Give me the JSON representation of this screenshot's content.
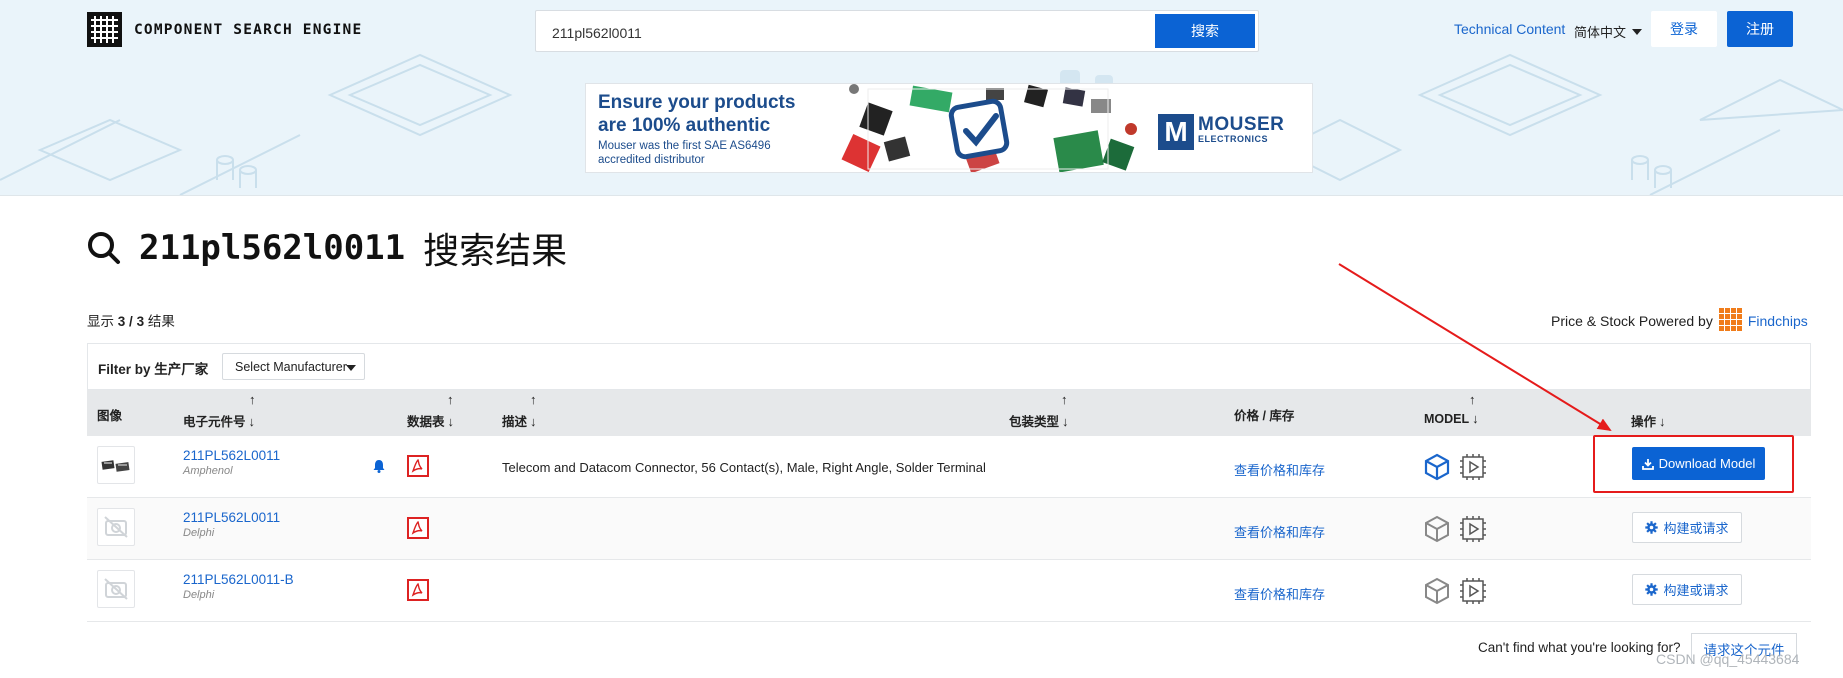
{
  "header": {
    "logo_text": "COMPONENT SEARCH ENGINE",
    "search_value": "211pl562l0011",
    "search_button": "搜索",
    "technical_content": "Technical Content",
    "language": "简体中文",
    "login": "登录",
    "register": "注册"
  },
  "banner": {
    "headline": "Ensure your products are 100% authentic",
    "subline": "Mouser was the first SAE AS6496 accredited distributor",
    "brand_letter": "M",
    "brand_name": "MOUSER",
    "brand_sub": "ELECTRONICS"
  },
  "results": {
    "query": "211pl562l0011",
    "title_suffix": "搜索结果",
    "count_prefix": "显示",
    "count_shown": "3",
    "count_sep": "/",
    "count_total": "3",
    "count_suffix": "结果",
    "powered_text": "Price & Stock Powered by",
    "powered_link": "Findchips"
  },
  "filter": {
    "label": "Filter by 生产厂家",
    "select_value": "Select Manufacturer"
  },
  "columns": {
    "image": "图像",
    "part_number": "电子元件号",
    "datasheet": "数据表",
    "description": "描述",
    "package": "包装类型",
    "price_stock": "价格 / 库存",
    "model": "MODEL",
    "actions": "操作"
  },
  "rows": [
    {
      "part_number": "211PL562L0011",
      "manufacturer": "Amphenol",
      "description": "Telecom and Datacom Connector, 56 Contact(s), Male, Right Angle, Solder Terminal",
      "price_link": "查看价格和库存",
      "action": "Download Model",
      "has_model": true
    },
    {
      "part_number": "211PL562L0011",
      "manufacturer": "Delphi",
      "description": "",
      "price_link": "查看价格和库存",
      "action": "构建或请求",
      "has_model": false
    },
    {
      "part_number": "211PL562L0011-B",
      "manufacturer": "Delphi",
      "description": "",
      "price_link": "查看价格和库存",
      "action": "构建或请求",
      "has_model": false
    }
  ],
  "footer": {
    "cant_find": "Can't find what you're looking for?",
    "request_button": "请求这个元件",
    "watermark": "CSDN @qq_45443684"
  },
  "colors": {
    "primary": "#0b63d4",
    "link": "#1a66cc",
    "hero_bg": "#eaf4fa",
    "annotation": "#e51b1b",
    "findchips": "#f07c1a"
  }
}
